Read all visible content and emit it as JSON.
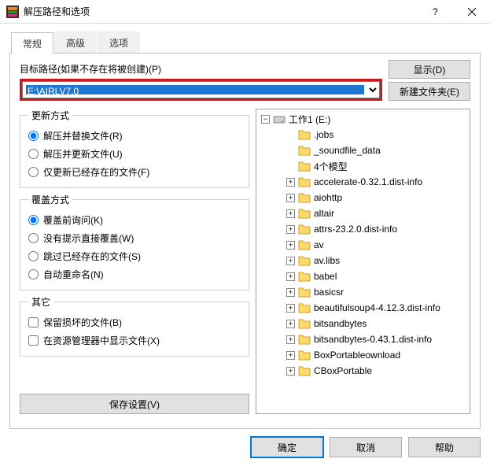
{
  "window": {
    "title": "解压路径和选项"
  },
  "tabs": {
    "general": "常规",
    "advanced": "高级",
    "options": "选项"
  },
  "path": {
    "label": "目标路径(如果不存在将被创建)(P)",
    "value": "E:\\AIRLV7.0",
    "display_btn": "显示(D)",
    "newfolder_btn": "新建文件夹(E)"
  },
  "update": {
    "legend": "更新方式",
    "extract_replace": "解压并替换文件(R)",
    "extract_update": "解压并更新文件(U)",
    "only_existing": "仅更新已经存在的文件(F)"
  },
  "overwrite": {
    "legend": "覆盖方式",
    "ask": "覆盖前询问(K)",
    "silent": "没有提示直接覆盖(W)",
    "skip": "跳过已经存在的文件(S)",
    "rename": "自动重命名(N)"
  },
  "misc": {
    "legend": "其它",
    "keep_broken": "保留损坏的文件(B)",
    "show_explorer": "在资源管理器中显示文件(X)"
  },
  "save_btn": "保存设置(V)",
  "tree": {
    "root": "工作1 (E:)",
    "items": [
      ".jobs",
      "_soundfile_data",
      "4个模型",
      "accelerate-0.32.1.dist-info",
      "aiohttp",
      "altair",
      "attrs-23.2.0.dist-info",
      "av",
      "av.libs",
      "babel",
      "basicsr",
      "beautifulsoup4-4.12.3.dist-info",
      "bitsandbytes",
      "bitsandbytes-0.43.1.dist-info",
      "BoxPortableownload",
      "CBoxPortable"
    ]
  },
  "dialog": {
    "ok": "确定",
    "cancel": "取消",
    "help": "帮助"
  }
}
